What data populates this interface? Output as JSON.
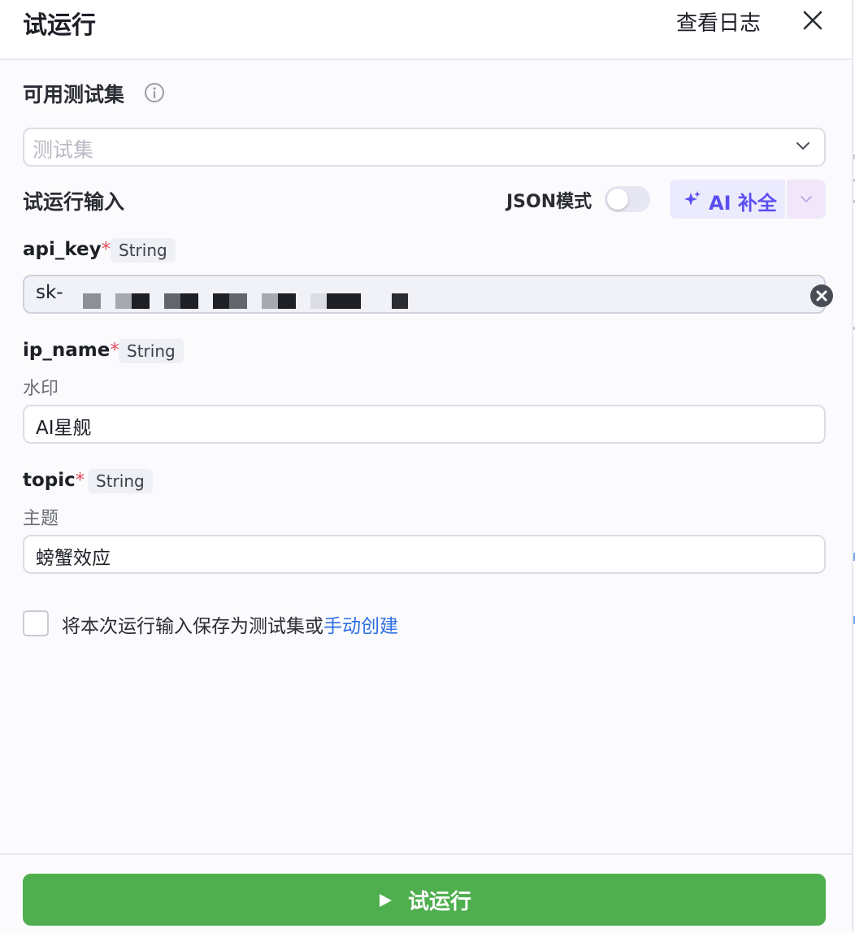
{
  "header": {
    "title": "试运行",
    "view_log": "查看日志"
  },
  "test_set": {
    "label": "可用测试集",
    "placeholder": "测试集"
  },
  "run_input": {
    "label": "试运行输入",
    "json_mode_label": "JSON模式",
    "json_mode_on": false,
    "ai_fill_label": "AI 补全"
  },
  "fields": [
    {
      "name": "api_key",
      "required_mark": "*",
      "type": "String",
      "description": "",
      "value": "sk-",
      "masked": true
    },
    {
      "name": "ip_name",
      "required_mark": "*",
      "type": "String",
      "description": "水印",
      "value": "AI星舰"
    },
    {
      "name": "topic",
      "required_mark": "*",
      "type": "String",
      "description": "主题",
      "value": "螃蟹效应"
    }
  ],
  "save": {
    "text": "将本次运行输入保存为测试集或",
    "link": "手动创建",
    "checked": false
  },
  "run_button": {
    "label": "试运行"
  },
  "colors": {
    "run_button": "#4fae4e",
    "link": "#2f6fe4",
    "ai_accent": "#5a4ef0",
    "required": "#e34d59"
  }
}
